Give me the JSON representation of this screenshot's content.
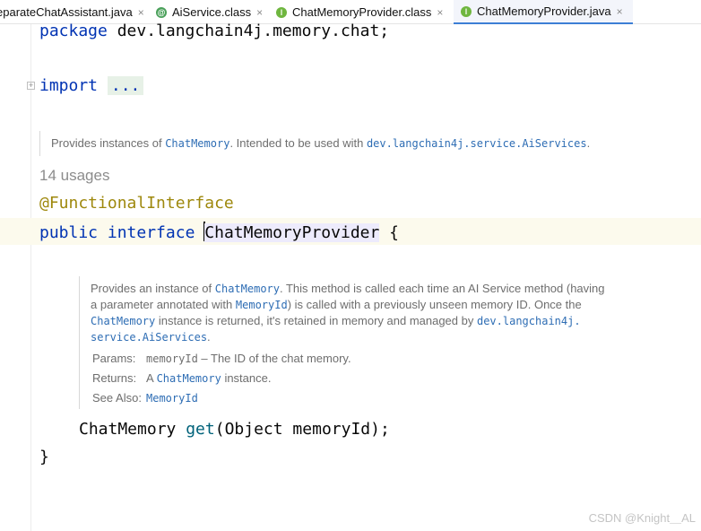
{
  "tabs": [
    {
      "label": "eparateChatAssistant.java",
      "icon": "",
      "active": false
    },
    {
      "label": "AiService.class",
      "icon": "annotation-icon",
      "active": false
    },
    {
      "label": "ChatMemoryProvider.class",
      "icon": "interface-icon",
      "active": false
    },
    {
      "label": "ChatMemoryProvider.java",
      "icon": "interface-icon",
      "active": true
    }
  ],
  "tab_close_glyph": "×",
  "code": {
    "package_kw": "package",
    "package_name": " dev.langchain4j.memory.chat;",
    "import_kw": "import",
    "import_folded": "...",
    "annotation": "@FunctionalInterface",
    "public_kw": "public",
    "interface_kw": "interface",
    "interface_name": "ChatMemoryProvider",
    "open_brace": " {",
    "method_type": "ChatMemory ",
    "method_name": "get",
    "method_params": "(Object memoryId);",
    "close_brace": "}"
  },
  "class_doc": {
    "prefix": "Provides instances of ",
    "ref1": "ChatMemory",
    "middle": ". Intended to be used with ",
    "ref2": "dev.langchain4j.service.AiServices",
    "suffix": "."
  },
  "usages": "14 usages",
  "method_doc": {
    "t1": "Provides an instance of ",
    "r1": "ChatMemory",
    "t2": ". This method is called each time an AI Service method (having",
    "t3": "a parameter annotated with ",
    "r2": "MemoryId",
    "t4": ") is called with a previously unseen memory ID. Once the",
    "r3": "ChatMemory",
    "t5": " instance is returned, it's retained in memory and managed by ",
    "r4": "dev.langchain4j.",
    "r5": "service.AiServices",
    "t6": ".",
    "params_label": "Params:",
    "params_name": "memoryId",
    "params_desc": " – The ID of the chat memory.",
    "returns_label": "Returns:",
    "returns_prefix": "A ",
    "returns_ref": "ChatMemory",
    "returns_suffix": " instance.",
    "seealso_label": "See Also:",
    "seealso_ref": "MemoryId"
  },
  "watermark": "CSDN @Knight＿AL"
}
